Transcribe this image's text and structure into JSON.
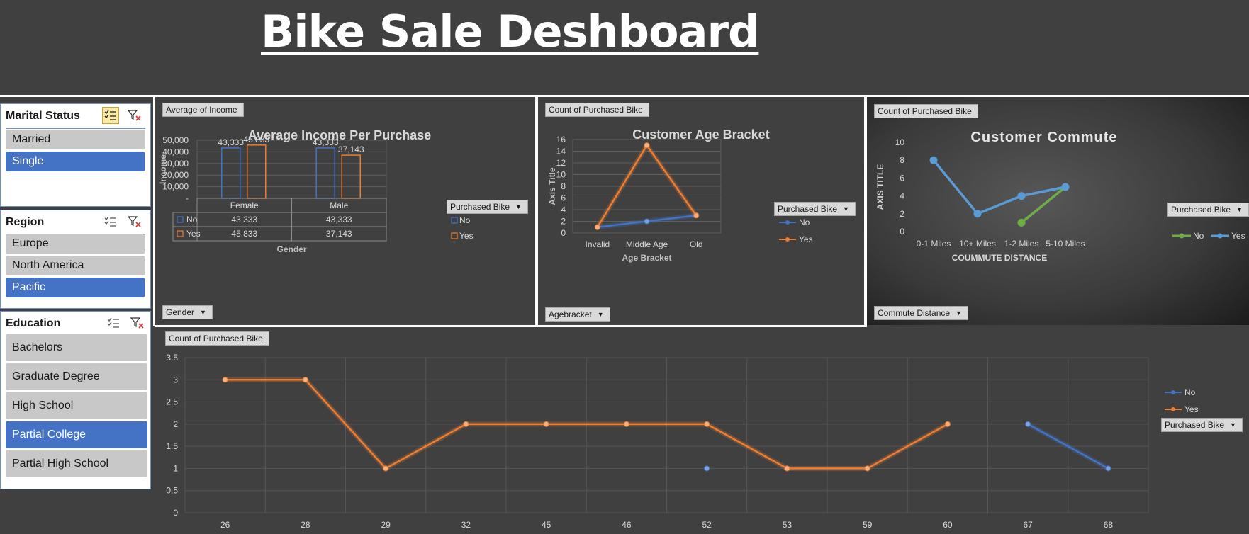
{
  "header": {
    "title": "Bike Sale Deshboard"
  },
  "slicers": {
    "marital": {
      "title": "Marital Status",
      "items": [
        {
          "label": "Married",
          "selected": false
        },
        {
          "label": "Single",
          "selected": true
        }
      ]
    },
    "region": {
      "title": "Region",
      "items": [
        {
          "label": "Europe",
          "selected": false
        },
        {
          "label": "North America",
          "selected": false
        },
        {
          "label": "Pacific",
          "selected": true
        }
      ]
    },
    "education": {
      "title": "Education",
      "items": [
        {
          "label": "Bachelors",
          "selected": false
        },
        {
          "label": "Graduate Degree",
          "selected": false
        },
        {
          "label": "High School",
          "selected": false
        },
        {
          "label": "Partial College",
          "selected": true
        },
        {
          "label": "Partial High School",
          "selected": false
        }
      ]
    }
  },
  "income_panel": {
    "value_button": "Average of Income",
    "axis_button": "Gender",
    "legend_button": "Purchased Bike"
  },
  "age_panel": {
    "value_button": "Count of Purchased Bike",
    "axis_button": "Agebracket",
    "legend_button": "Purchased Bike"
  },
  "commute_panel": {
    "value_button": "Count of Purchased Bike",
    "axis_button": "Commute Distance",
    "legend_button": "Purchased Bike"
  },
  "age_line_panel": {
    "value_button": "Count of Purchased Bike",
    "legend_button": "Purchased Bike"
  },
  "colors": {
    "no_blue": "#4472c4",
    "yes_orange": "#ed7d31",
    "commute_no": "#70ad47",
    "commute_yes": "#5b9bd5",
    "selected_slicer": "#4472c4"
  },
  "icons": {
    "multi_select": "multi-select-icon",
    "clear_filter": "clear-filter-icon",
    "dropdown": "dropdown-arrow-icon"
  },
  "chart_data": [
    {
      "type": "bar",
      "title": "Average Income Per Purchase",
      "xlabel": "Gender",
      "ylabel": "Income",
      "categories": [
        "Female",
        "Male"
      ],
      "yticks": [
        "50,000",
        "40,000",
        "30,000",
        "20,000",
        "10,000",
        "-"
      ],
      "ylim": [
        0,
        50000
      ],
      "series": [
        {
          "name": "No",
          "values": [
            43333,
            43333
          ],
          "labels": [
            "43,333",
            "43,333"
          ]
        },
        {
          "name": "Yes",
          "values": [
            45833,
            37143
          ],
          "labels": [
            "45,833",
            "37,143"
          ]
        }
      ],
      "data_table": true,
      "legend": "right"
    },
    {
      "type": "line",
      "title": "Customer Age Bracket",
      "xlabel": "Age Bracket",
      "ylabel": "Axis Title",
      "categories": [
        "Invalid",
        "Middle Age",
        "Old"
      ],
      "ylim": [
        0,
        16
      ],
      "yticks": [
        0,
        2,
        4,
        6,
        8,
        10,
        12,
        14,
        16
      ],
      "series": [
        {
          "name": "No",
          "values": [
            1,
            2,
            3
          ]
        },
        {
          "name": "Yes",
          "values": [
            1,
            15,
            3
          ]
        }
      ],
      "legend": "right"
    },
    {
      "type": "line",
      "title": "Customer Commute",
      "xlabel": "COUMMUTE DISTANCE",
      "ylabel": "AXIS TITLE",
      "categories": [
        "0-1 Miles",
        "10+ Miles",
        "1-2 Miles",
        "5-10 Miles"
      ],
      "ylim": [
        0,
        10
      ],
      "yticks": [
        0,
        2,
        4,
        6,
        8,
        10
      ],
      "series": [
        {
          "name": "No",
          "values": [
            null,
            null,
            1,
            5
          ]
        },
        {
          "name": "Yes",
          "values": [
            8,
            2,
            4,
            5
          ]
        }
      ],
      "legend": "right"
    },
    {
      "type": "line",
      "title": "",
      "categories": [
        "26",
        "28",
        "29",
        "32",
        "45",
        "46",
        "52",
        "53",
        "59",
        "60",
        "67",
        "68"
      ],
      "ylim": [
        0,
        3.5
      ],
      "yticks": [
        "0",
        "0.5",
        "1",
        "1.5",
        "2",
        "2.5",
        "3",
        "3.5"
      ],
      "series": [
        {
          "name": "No",
          "values": [
            null,
            null,
            null,
            null,
            null,
            null,
            1,
            null,
            null,
            null,
            2,
            1
          ]
        },
        {
          "name": "Yes",
          "values": [
            3,
            3,
            1,
            2,
            2,
            2,
            2,
            1,
            1,
            2,
            null,
            null
          ]
        }
      ],
      "legend": "right"
    }
  ]
}
